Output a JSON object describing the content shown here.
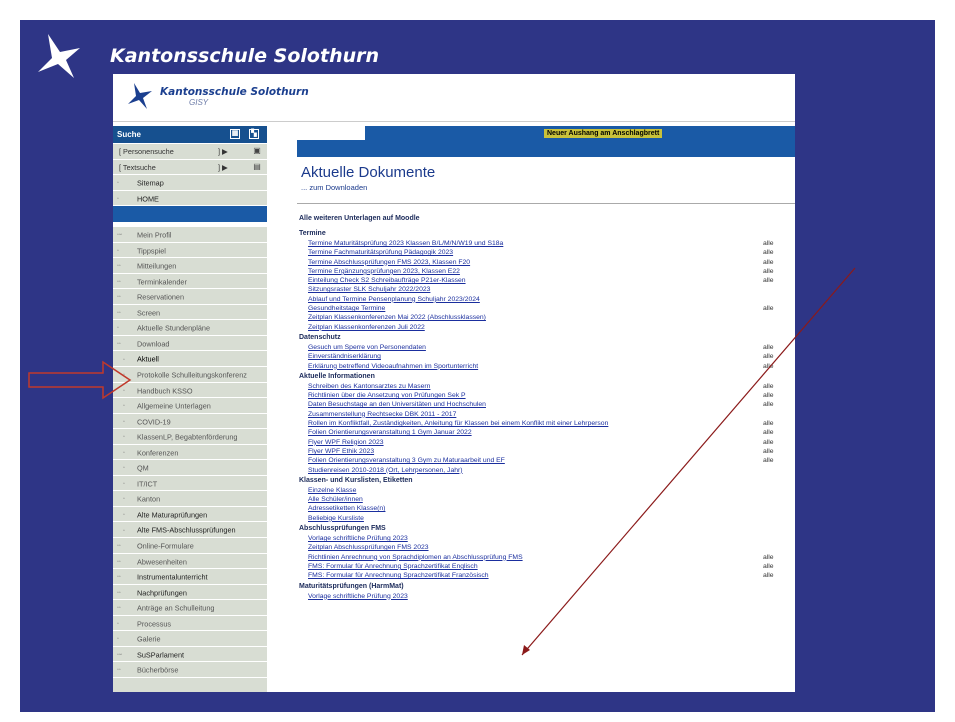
{
  "slide": {
    "title": "Kantonsschule Solothurn",
    "background": "#2e3586"
  },
  "header": {
    "title": "Kantonsschule Solothurn",
    "subtitle": "GISY"
  },
  "sidebar": {
    "search_label": "Suche",
    "search_rows": [
      {
        "label": "[ Personensuche",
        "btn": "] ▶"
      },
      {
        "label": "[ Textsuche",
        "btn": "] ▶"
      }
    ],
    "top_items": [
      {
        "label": "Sitemap"
      },
      {
        "label": "HOME"
      }
    ],
    "items": [
      {
        "bullet": "▫▫▫",
        "label": "Mein Profil"
      },
      {
        "bullet": "▫",
        "label": "Tippspiel"
      },
      {
        "bullet": "▫▫",
        "label": "Mitteilungen"
      },
      {
        "bullet": "▫▫",
        "label": "Terminkalender"
      },
      {
        "bullet": "▫▫",
        "label": "Reservationen"
      },
      {
        "bullet": "▫▫",
        "label": "Screen"
      },
      {
        "bullet": "▫",
        "label": "Aktuelle Stundenpläne"
      },
      {
        "bullet": "▫▫",
        "label": "Download"
      }
    ],
    "download_sub": [
      {
        "label": "Aktuell"
      },
      {
        "label": "Protokolle Schulleitungskonferenz"
      },
      {
        "label": "Handbuch KSSO"
      },
      {
        "label": "Allgemeine Unterlagen"
      },
      {
        "label": "COVID-19"
      },
      {
        "label": "KlassenLP, Begabtenförderung"
      },
      {
        "label": "Konferenzen"
      },
      {
        "label": "QM"
      },
      {
        "label": "IT/ICT"
      },
      {
        "label": "Kanton"
      },
      {
        "label": "Alte Maturaprüfungen"
      },
      {
        "label": "Alte FMS-Abschlussprüfungen"
      }
    ],
    "bottom_items": [
      {
        "bullet": "▫▫",
        "label": "Online-Formulare"
      },
      {
        "bullet": "▫▫",
        "label": "Abwesenheiten"
      },
      {
        "bullet": "▫▫",
        "label": "Instrumentalunterricht"
      },
      {
        "bullet": "▫▫",
        "label": "Nachprüfungen"
      },
      {
        "bullet": "▫▫",
        "label": "Anträge an Schulleitung"
      },
      {
        "bullet": "▫",
        "label": "Processus"
      },
      {
        "bullet": "▫",
        "label": "Galerie"
      },
      {
        "bullet": "▫▫▫",
        "label": "SuSParlament"
      },
      {
        "bullet": "▫▫",
        "label": "Bücherbörse"
      }
    ]
  },
  "main": {
    "notice": "Neuer Aushang am Anschlagbrett",
    "title": "Aktuelle Dokumente",
    "subtitle": "... zum Downloaden",
    "moodle": "Alle weiteren Unterlagen auf Moodle",
    "sections": [
      {
        "title": "Termine",
        "docs": [
          {
            "label": "Termine Maturitätsprüfung 2023 Klassen B/L/M/N/W19 und S18a",
            "aud": "alle"
          },
          {
            "label": "Termine Fachmaturitätsprüfung Pädagogik 2023",
            "aud": "alle"
          },
          {
            "label": "Termine Abschlussprüfungen FMS 2023, Klassen F20",
            "aud": "alle"
          },
          {
            "label": "Termine Ergänzungsprüfungen 2023, Klassen E22",
            "aud": "alle"
          },
          {
            "label": "Einteilung Check S2 Schreibaufträge P21er-Klassen",
            "aud": "alle"
          },
          {
            "label": "Sitzungsraster SLK Schuljahr 2022/2023",
            "aud": ""
          },
          {
            "label": "Ablauf und Termine Pensenplanung Schuljahr 2023/2024",
            "aud": ""
          },
          {
            "label": "Gesundheitstage Termine",
            "aud": "alle"
          },
          {
            "label": "Zeitplan Klassenkonferenzen Mai 2022 (Abschlussklassen)",
            "aud": ""
          },
          {
            "label": "Zeitplan Klassenkonferenzen Juli 2022",
            "aud": ""
          }
        ]
      },
      {
        "title": "Datenschutz",
        "docs": [
          {
            "label": "Gesuch um Sperre von Personendaten",
            "aud": "alle"
          },
          {
            "label": "Einverständniserklärung",
            "aud": "alle"
          },
          {
            "label": "Erklärung betreffend Videoaufnahmen im Sportunterricht",
            "aud": "alle"
          }
        ]
      },
      {
        "title": "Aktuelle Informationen",
        "docs": [
          {
            "label": "Schreiben des Kantonsarztes zu Masern",
            "aud": "alle"
          },
          {
            "label": "Richtlinien über die Ansetzung von Prüfungen Sek P",
            "aud": "alle"
          },
          {
            "label": "Daten Besuchstage an den Universitäten und Hochschulen",
            "aud": "alle"
          },
          {
            "label": "Zusammenstellung Rechtsecke DBK 2011 - 2017",
            "aud": ""
          },
          {
            "label": "Rollen im Konfliktfall, Zuständigkeiten, Anleitung für Klassen bei einem Konflikt mit einer Lehrperson",
            "aud": "alle"
          },
          {
            "label": "Folien Orientierungsveranstaltung 1 Gym Januar 2022",
            "aud": "alle"
          },
          {
            "label": "Flyer WPF Religion 2023",
            "aud": "alle"
          },
          {
            "label": "Flyer WPF Ethik 2023",
            "aud": "alle"
          },
          {
            "label": "Folien Orientierungsveranstaltung 3 Gym zu Maturaarbeit und EF",
            "aud": "alle"
          },
          {
            "label": "Studienreisen 2010-2018 (Ort, Lehrpersonen, Jahr)",
            "aud": ""
          }
        ]
      },
      {
        "title": "Klassen- und Kurslisten, Etiketten",
        "docs": [
          {
            "label": "Einzelne Klasse",
            "aud": ""
          },
          {
            "label": "Alle Schüler/innen",
            "aud": ""
          },
          {
            "label": "Adressetiketten Klasse(n)",
            "aud": ""
          },
          {
            "label": "Beliebige Kursliste",
            "aud": ""
          }
        ]
      },
      {
        "title": "Abschlussprüfungen FMS",
        "docs": [
          {
            "label": "Vorlage schriftliche Prüfung 2023",
            "aud": ""
          },
          {
            "label": "Zeitplan Abschlussprüfungen FMS 2023",
            "aud": ""
          },
          {
            "label": "Richtlinien Anrechnung von Sprachdiplomen an Abschlussprüfung FMS",
            "aud": "alle"
          },
          {
            "label": "FMS: Formular für Anrechnung Sprachzertifikat Englisch",
            "aud": "alle"
          },
          {
            "label": "FMS: Formular für Anrechnung Sprachzertifikat Französisch",
            "aud": "alle"
          }
        ]
      },
      {
        "title": "Maturitätsprüfungen (HarmMat)",
        "docs": [
          {
            "label": "Vorlage schriftliche Prüfung 2023",
            "aud": ""
          }
        ]
      }
    ]
  },
  "colors": {
    "link": "#1a2e9e",
    "sidebar_bg": "#d8ddd3",
    "header_blue": "#1a5aa6",
    "annotation_red": "#c0392b"
  }
}
